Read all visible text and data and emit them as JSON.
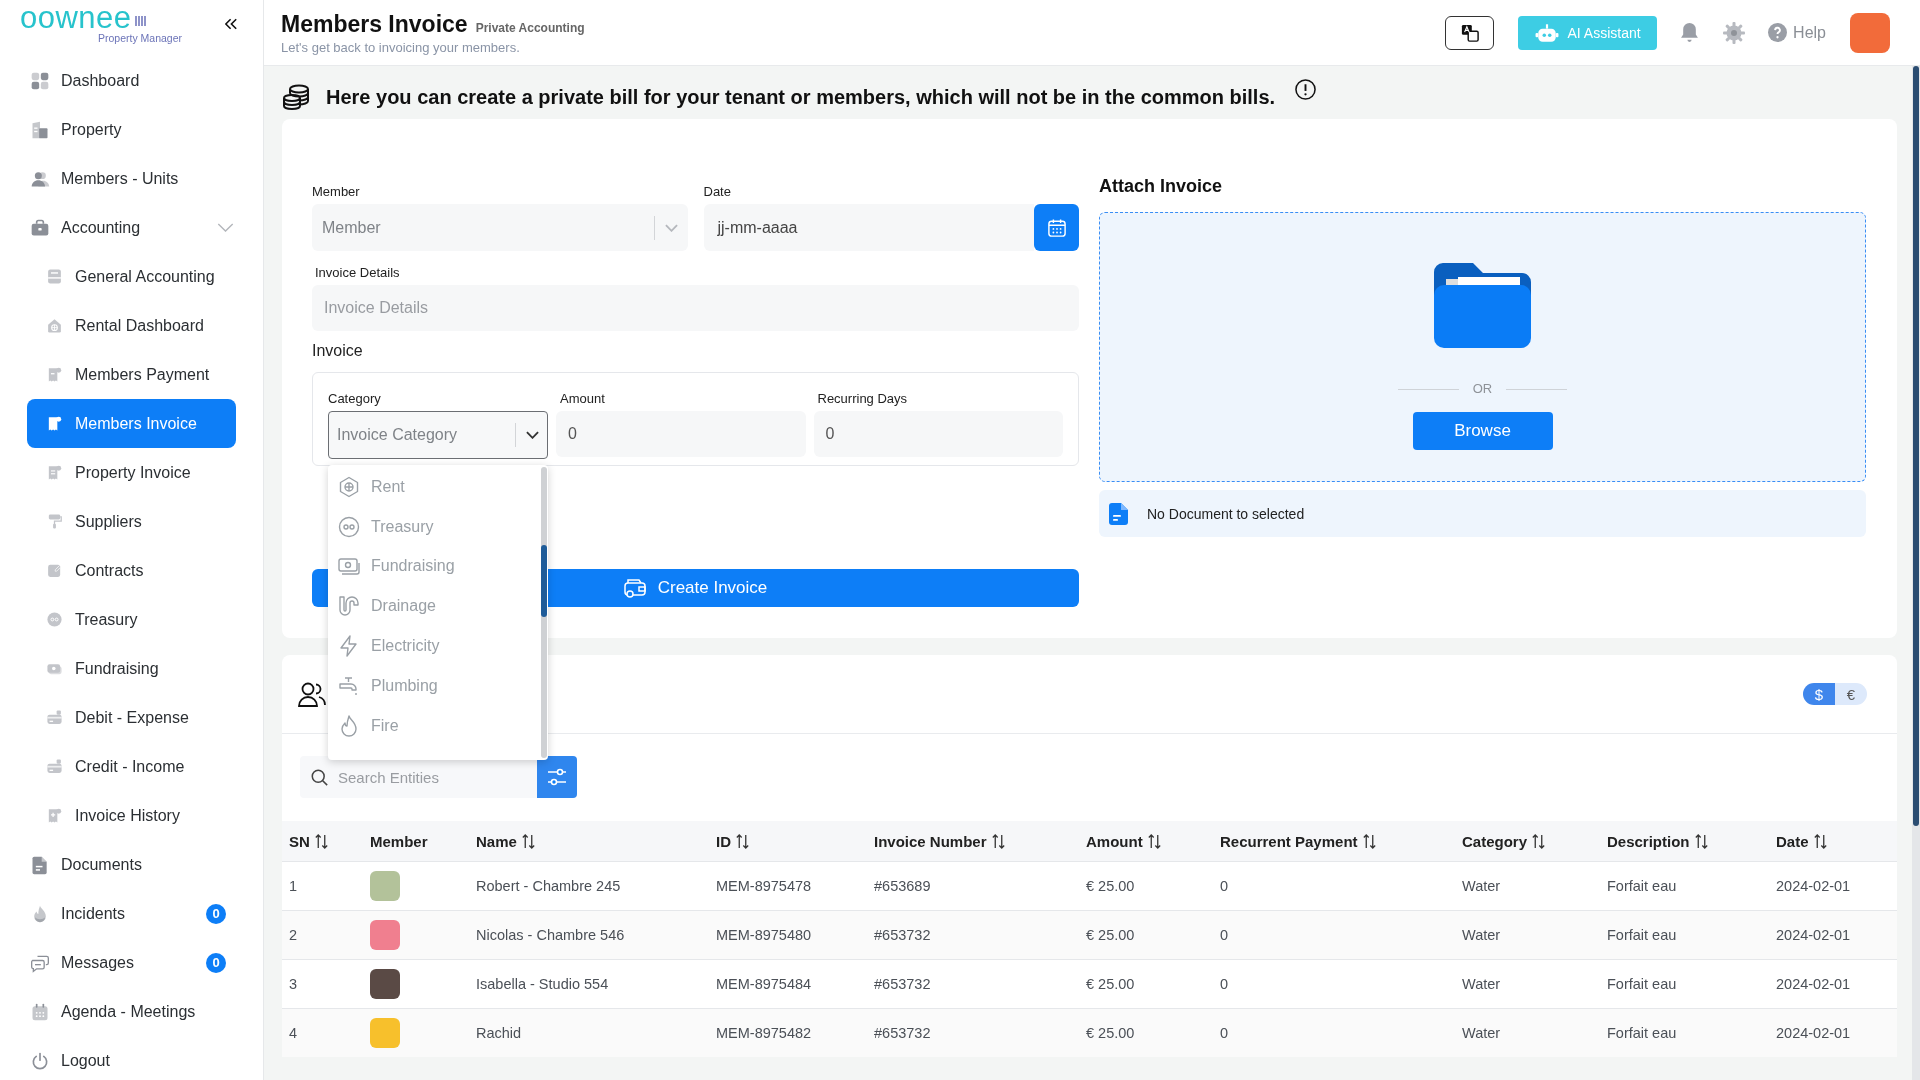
{
  "sidebar": {
    "logo": {
      "name": "oownee",
      "tagline": "Property Manager"
    },
    "items": [
      {
        "label": "Dashboard",
        "selected": false
      },
      {
        "label": "Property",
        "selected": false
      },
      {
        "label": "Members - Units",
        "selected": false
      },
      {
        "label": "Accounting",
        "selected": false,
        "expanded": true,
        "children": [
          {
            "label": "General Accounting",
            "selected": false
          },
          {
            "label": "Rental Dashboard",
            "selected": false
          },
          {
            "label": "Members Payment",
            "selected": false
          },
          {
            "label": "Members Invoice",
            "selected": true
          },
          {
            "label": "Property Invoice",
            "selected": false
          },
          {
            "label": "Suppliers",
            "selected": false
          },
          {
            "label": "Contracts",
            "selected": false
          },
          {
            "label": "Treasury",
            "selected": false
          },
          {
            "label": "Fundraising",
            "selected": false
          },
          {
            "label": "Debit - Expense",
            "selected": false
          },
          {
            "label": "Credit - Income",
            "selected": false
          },
          {
            "label": "Invoice History",
            "selected": false
          }
        ]
      },
      {
        "label": "Documents",
        "selected": false
      },
      {
        "label": "Incidents",
        "selected": false,
        "badge": "0"
      },
      {
        "label": "Messages",
        "selected": false,
        "badge": "0"
      },
      {
        "label": "Agenda - Meetings",
        "selected": false
      },
      {
        "label": "Logout",
        "selected": false
      }
    ]
  },
  "header": {
    "title": "Members Invoice",
    "tag": "Private Accounting",
    "subtitle": "Let's get back to invoicing your members.",
    "ai_button": "AI Assistant",
    "help": "Help"
  },
  "banner": {
    "text": "Here you can create a private bill for your tenant or members, which will not be in the common bills."
  },
  "invoice_form": {
    "member": {
      "label": "Member",
      "placeholder": "Member"
    },
    "date": {
      "label": "Date",
      "placeholder": "jj-mm-aaaa"
    },
    "details": {
      "label": "Invoice Details",
      "placeholder": "Invoice Details"
    },
    "invoice": {
      "label": "Invoice",
      "category": {
        "label": "Category",
        "placeholder": "Invoice Category",
        "expanded": true,
        "options": [
          {
            "label": "Rent",
            "selected": false
          },
          {
            "label": "Treasury",
            "selected": false
          },
          {
            "label": "Fundraising",
            "selected": false
          },
          {
            "label": "Drainage",
            "selected": false
          },
          {
            "label": "Electricity",
            "selected": false
          },
          {
            "label": "Plumbing",
            "selected": false
          },
          {
            "label": "Fire",
            "selected": false
          }
        ]
      },
      "amount": {
        "label": "Amount",
        "value": "0"
      },
      "recurring_days": {
        "label": "Recurring Days",
        "value": "0"
      }
    },
    "submit": "Create Invoice"
  },
  "attach": {
    "title": "Attach Invoice",
    "separator": "OR",
    "browse": "Browse",
    "status": "No Document to selected"
  },
  "entities": {
    "currencies": [
      {
        "label": "$",
        "selected": true
      },
      {
        "label": "€",
        "selected": false
      }
    ],
    "search": {
      "placeholder": "Search Entities"
    },
    "table": {
      "columns": [
        {
          "label": "SN",
          "sortable": true
        },
        {
          "label": "Member",
          "sortable": false
        },
        {
          "label": "Name",
          "sortable": true
        },
        {
          "label": "ID",
          "sortable": true
        },
        {
          "label": "Invoice Number",
          "sortable": true
        },
        {
          "label": "Amount",
          "sortable": true
        },
        {
          "label": "Recurrent Payment",
          "sortable": true
        },
        {
          "label": "Category",
          "sortable": true
        },
        {
          "label": "Description",
          "sortable": true
        },
        {
          "label": "Date",
          "sortable": true
        }
      ],
      "rows": [
        {
          "sn": "1",
          "color": "#b3c29a",
          "name": "Robert - Chambre 245",
          "id": "MEM-8975478",
          "invoice_number": "#653689",
          "amount": "€ 25.00",
          "recurrent_payment": "0",
          "category": "Water",
          "description": "Forfait eau",
          "date": "2024-02-01"
        },
        {
          "sn": "2",
          "color": "#f07f8f",
          "name": "Nicolas - Chambre 546",
          "id": "MEM-8975480",
          "invoice_number": "#653732",
          "amount": "€ 25.00",
          "recurrent_payment": "0",
          "category": "Water",
          "description": "Forfait eau",
          "date": "2024-02-01"
        },
        {
          "sn": "3",
          "color": "#5a4a45",
          "name": "Isabella - Studio 554",
          "id": "MEM-8975484",
          "invoice_number": "#653732",
          "amount": "€ 25.00",
          "recurrent_payment": "0",
          "category": "Water",
          "description": "Forfait eau",
          "date": "2024-02-01"
        },
        {
          "sn": "4",
          "color": "#f7c02c",
          "name": "Rachid",
          "id": "MEM-8975482",
          "invoice_number": "#653732",
          "amount": "€ 25.00",
          "recurrent_payment": "0",
          "category": "Water",
          "description": "Forfait eau",
          "date": "2024-02-01"
        }
      ]
    }
  }
}
